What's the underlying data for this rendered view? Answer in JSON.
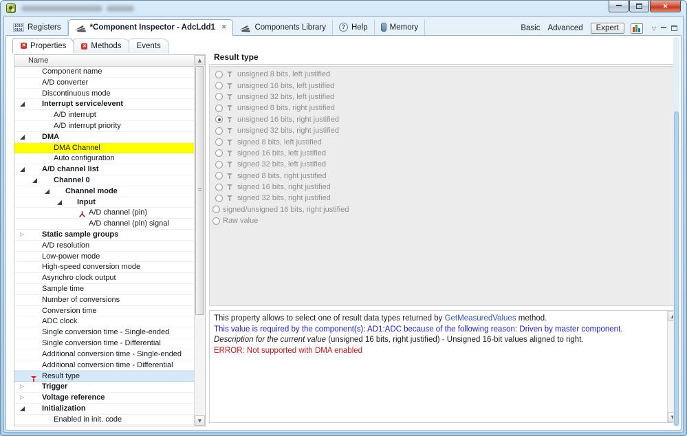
{
  "window": {
    "title_redacted": true,
    "close_glyph": "✕"
  },
  "tabbar": {
    "tabs": [
      {
        "label": "Registers",
        "icon": "registers-binary-icon",
        "active": false,
        "closable": false
      },
      {
        "label": "*Component Inspector - AdcLdd1",
        "icon": "component-icon",
        "active": true,
        "closable": true
      },
      {
        "label": "Components Library",
        "icon": "component-icon",
        "active": false,
        "closable": false
      },
      {
        "label": "Help",
        "icon": "help-icon",
        "active": false,
        "closable": false
      },
      {
        "label": "Memory",
        "icon": "memory-icon",
        "active": false,
        "closable": false
      }
    ],
    "view_modes": [
      {
        "label": "Basic",
        "selected": false
      },
      {
        "label": "Advanced",
        "selected": false
      },
      {
        "label": "Expert",
        "selected": true
      }
    ]
  },
  "inner_tabs": [
    {
      "label": "Properties",
      "has_error_icon": true,
      "active": true
    },
    {
      "label": "Methods",
      "has_error_icon": true,
      "active": false
    },
    {
      "label": "Events",
      "has_error_icon": false,
      "active": false
    }
  ],
  "tree": {
    "header": "Name",
    "rows": [
      {
        "label": "Component name",
        "level": 0
      },
      {
        "label": "A/D converter",
        "level": 0
      },
      {
        "label": "Discontinuous mode",
        "level": 0
      },
      {
        "label": "Interrupt service/event",
        "level": 0,
        "bold": true,
        "expand": "open"
      },
      {
        "label": "A/D interrupt",
        "level": 1
      },
      {
        "label": "A/D interrupt priority",
        "level": 1
      },
      {
        "label": "DMA",
        "level": 0,
        "bold": true,
        "expand": "open"
      },
      {
        "label": "DMA Channel",
        "level": 1,
        "highlight": "yellow"
      },
      {
        "label": "Auto configuration",
        "level": 1
      },
      {
        "label": "A/D channel list",
        "level": 0,
        "bold": true,
        "expand": "open"
      },
      {
        "label": "Channel 0",
        "level": 1,
        "bold": true,
        "expand": "open"
      },
      {
        "label": "Channel mode",
        "level": 2,
        "bold": true,
        "expand": "open"
      },
      {
        "label": "Input",
        "level": 3,
        "bold": true,
        "expand": "open"
      },
      {
        "label": "A/D channel (pin)",
        "level": 4,
        "icon": "pin"
      },
      {
        "label": "A/D channel (pin) signal",
        "level": 4
      },
      {
        "label": "Static sample groups",
        "level": 0,
        "bold": true,
        "expand": "closed"
      },
      {
        "label": "A/D resolution",
        "level": 0
      },
      {
        "label": "Low-power mode",
        "level": 0
      },
      {
        "label": "High-speed conversion mode",
        "level": 0
      },
      {
        "label": "Asynchro clock output",
        "level": 0
      },
      {
        "label": "Sample time",
        "level": 0
      },
      {
        "label": "Number of conversions",
        "level": 0
      },
      {
        "label": "Conversion time",
        "level": 0
      },
      {
        "label": "ADC clock",
        "level": 0
      },
      {
        "label": "Single conversion time - Single-ended",
        "level": 0
      },
      {
        "label": "Single conversion time - Differential",
        "level": 0
      },
      {
        "label": "Additional conversion time - Single-ended",
        "level": 0
      },
      {
        "label": "Additional conversion time - Differential",
        "level": 0
      },
      {
        "label": "Result type",
        "level": 0,
        "icon": "error-funnel",
        "highlight": "selected"
      },
      {
        "label": "Trigger",
        "level": 0,
        "bold": true,
        "expand": "closed"
      },
      {
        "label": "Voltage reference",
        "level": 0,
        "bold": true,
        "expand": "closed"
      },
      {
        "label": "Initialization",
        "level": 0,
        "bold": true,
        "expand": "open"
      },
      {
        "label": "Enabled in init. code",
        "level": 1
      }
    ]
  },
  "result_panel": {
    "title": "Result type",
    "selected_index": 4,
    "options": [
      {
        "label": "unsigned 8 bits, left justified",
        "funnel": true
      },
      {
        "label": "unsigned 16 bits, left justified",
        "funnel": true
      },
      {
        "label": "unsigned 32 bits, left justified",
        "funnel": true
      },
      {
        "label": "unsigned 8 bits, right justified",
        "funnel": true
      },
      {
        "label": "unsigned 16 bits, right justified",
        "funnel": true
      },
      {
        "label": "unsigned 32 bits, right justified",
        "funnel": true
      },
      {
        "label": "signed 8 bits, left justified",
        "funnel": true
      },
      {
        "label": "signed 16 bits, left justified",
        "funnel": true
      },
      {
        "label": "signed 32 bits, left justified",
        "funnel": true
      },
      {
        "label": "signed 8 bits, right justified",
        "funnel": true
      },
      {
        "label": "signed 16 bits, right justified",
        "funnel": true
      },
      {
        "label": "signed 32 bits, right justified",
        "funnel": true
      },
      {
        "label": "signed/unsigned 16 bits, right justified",
        "funnel": false
      },
      {
        "label": "Raw value",
        "funnel": false
      }
    ]
  },
  "description": {
    "lines": [
      {
        "parts": [
          {
            "text": "This property allows to select one of result data types returned by ",
            "style": "normal"
          },
          {
            "text": "GetMeasuredValues",
            "style": "link"
          },
          {
            "text": " method.",
            "style": "normal"
          }
        ]
      },
      {
        "parts": [
          {
            "text": "This value is required by the component(s): AD1:ADC because of the following reason: Driven by master component.",
            "style": "blue"
          }
        ]
      },
      {
        "parts": [
          {
            "text": "Description for the current value",
            "style": "italic"
          },
          {
            "text": " (unsigned 16 bits, right justified) - Unsigned 16-bit values aligned to right.",
            "style": "normal"
          }
        ]
      },
      {
        "parts": [
          {
            "text": "ERROR: Not supported with DMA enabled",
            "style": "error"
          }
        ]
      }
    ]
  },
  "colors": {
    "highlight_yellow": "#ffff00",
    "selection_blue": "#d7e8f9",
    "error_red": "#c01818",
    "link_blue": "#3355bb",
    "info_blue": "#2121bd"
  }
}
